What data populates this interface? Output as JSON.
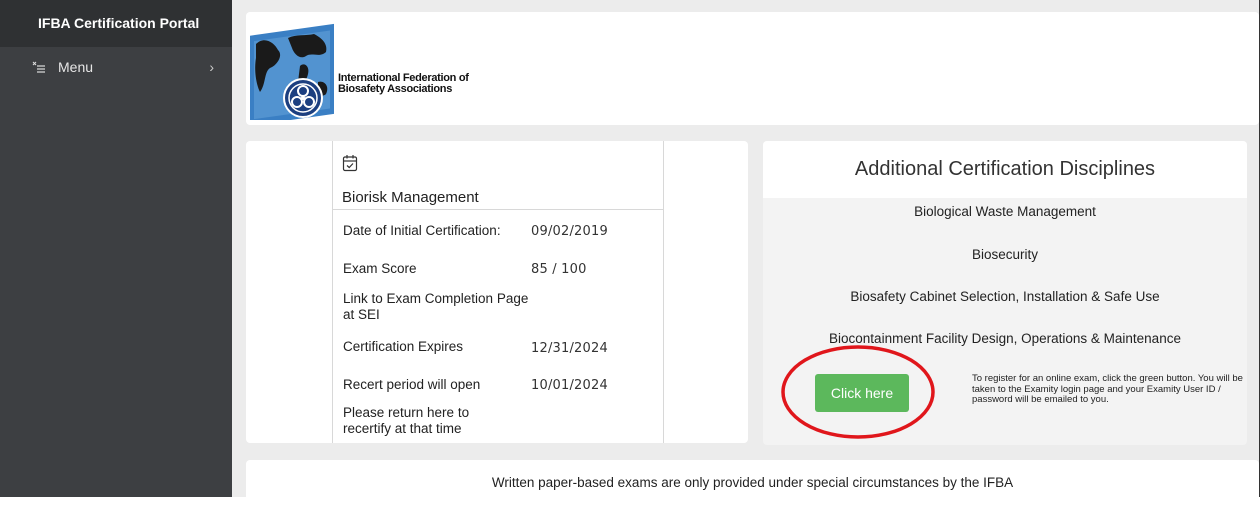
{
  "sidebar": {
    "title": "IFBA Certification Portal",
    "menu_label": "Menu",
    "menu_chevron": "›"
  },
  "header": {
    "org_line1": "International Federation of",
    "org_line2": "Biosafety Associations"
  },
  "certification": {
    "title": "Biorisk Management",
    "rows": [
      {
        "label": "Date of Initial Certification:",
        "value": "09/02/2019"
      },
      {
        "label": "Exam Score",
        "value": "85 / 100"
      },
      {
        "label": "Link to Exam Completion Page at SEI",
        "value": ""
      },
      {
        "label": "Certification Expires",
        "value": "12/31/2024"
      },
      {
        "label": "Recert period will open",
        "value": "10/01/2024"
      }
    ],
    "recert_note": "Please return here to recertify at that time"
  },
  "disciplines": {
    "title": "Additional Certification Disciplines",
    "items": [
      "Biological Waste Management",
      "Biosecurity",
      "Biosafety Cabinet Selection, Installation & Safe Use",
      "Biocontainment Facility Design, Operations & Maintenance"
    ],
    "button_label": "Click here",
    "register_note": "To register for an online exam, click the green button. You will be taken to the Examity login page and your Examity User ID / password will be emailed to you."
  },
  "footer": {
    "note": "Written paper-based exams are only provided under special circumstances by the IFBA"
  },
  "colors": {
    "sidebar_bg": "#3d3f42",
    "sidebar_title_bg": "#2f3133",
    "button_green": "#5cb85c",
    "highlight_red": "#e0161b",
    "logo_blue": "#2a6fb5"
  },
  "icons": [
    "menu-icon",
    "chevron-right-icon",
    "globe-logo-icon",
    "biohazard-icon",
    "calendar-check-icon"
  ]
}
